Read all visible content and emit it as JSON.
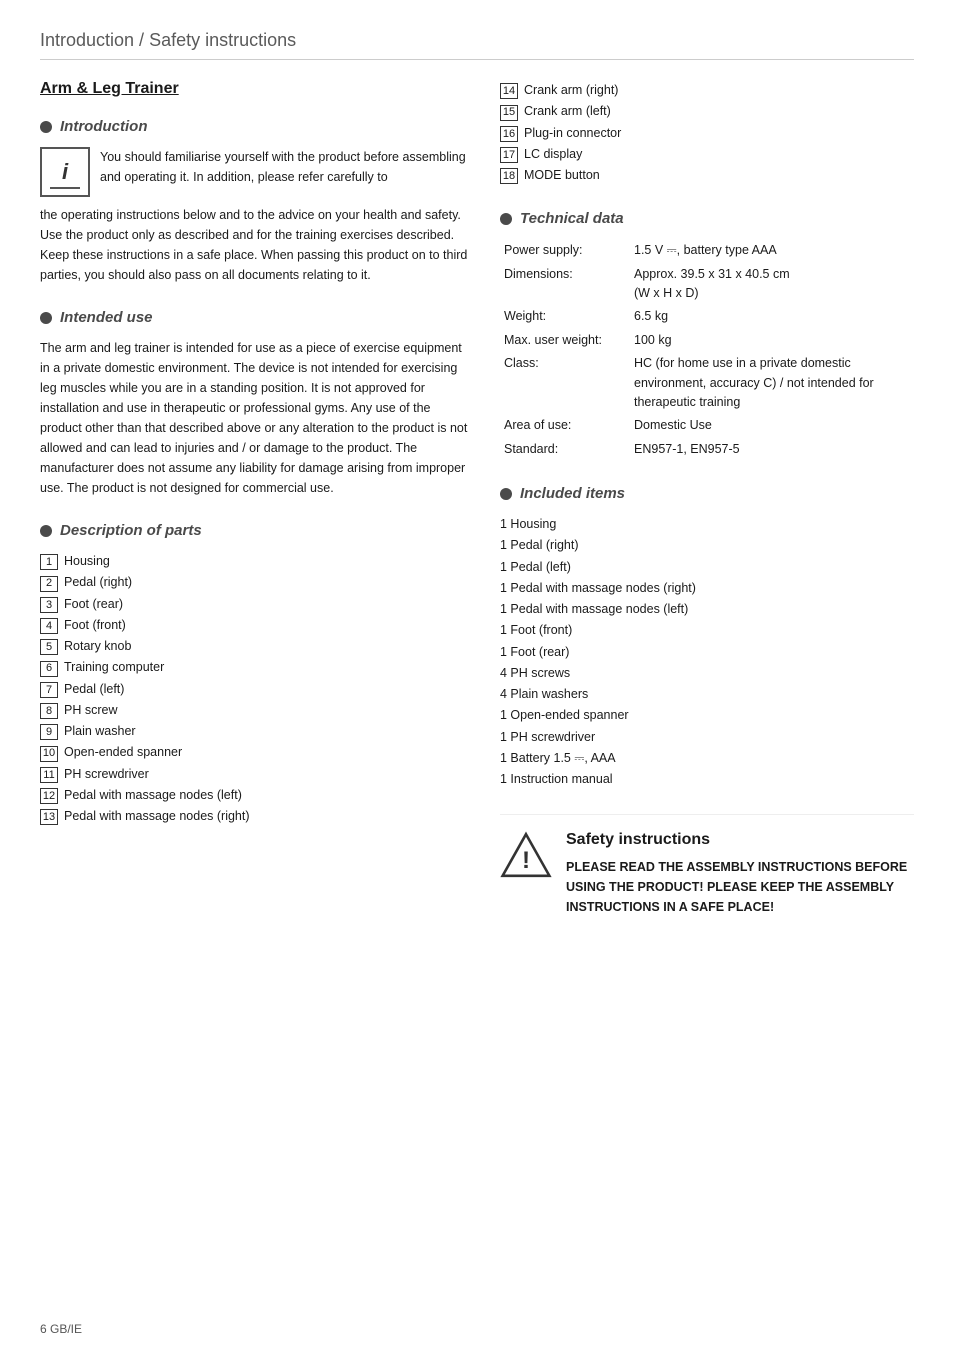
{
  "header": {
    "title": "Introduction / Safety instructions"
  },
  "left_col": {
    "product_title": "Arm & Leg Trainer",
    "intro_section": {
      "heading": "Introduction",
      "text1": "You should familiarise yourself with the product before assembling and operating it. In addition, please refer carefully to the operating instructions below and to the advice on your health and safety. Use the product only as described and for the training exercises described. Keep these instructions in a safe place. When passing this product on to third parties, you should also pass on all documents relating to it."
    },
    "intended_use": {
      "heading": "Intended use",
      "text": "The arm and leg trainer is intended for use as a piece of exercise equipment in a private domestic environment. The device is not intended for exercising leg muscles while you are in a standing position. It is not approved for installation and use in therapeutic or professional gyms. Any use of the product other than that described above or any alteration to the product is not allowed and can lead to injuries and / or damage to the product. The manufacturer does not assume any liability for damage arising from improper use. The product is not designed for commercial use."
    },
    "description_of_parts": {
      "heading": "Description of parts",
      "items": [
        {
          "num": "1",
          "label": "Housing"
        },
        {
          "num": "2",
          "label": "Pedal (right)"
        },
        {
          "num": "3",
          "label": "Foot (rear)"
        },
        {
          "num": "4",
          "label": "Foot (front)"
        },
        {
          "num": "5",
          "label": "Rotary knob"
        },
        {
          "num": "6",
          "label": "Training computer"
        },
        {
          "num": "7",
          "label": "Pedal (left)"
        },
        {
          "num": "8",
          "label": "PH screw"
        },
        {
          "num": "9",
          "label": "Plain washer"
        },
        {
          "num": "10",
          "label": "Open-ended spanner"
        },
        {
          "num": "11",
          "label": "PH screwdriver"
        },
        {
          "num": "12",
          "label": "Pedal with massage nodes (left)"
        },
        {
          "num": "13",
          "label": "Pedal with massage nodes (right)"
        }
      ]
    }
  },
  "right_col": {
    "parts_continued": [
      {
        "num": "14",
        "label": "Crank arm (right)"
      },
      {
        "num": "15",
        "label": "Crank arm (left)"
      },
      {
        "num": "16",
        "label": "Plug-in connector"
      },
      {
        "num": "17",
        "label": "LC display"
      },
      {
        "num": "18",
        "label": "MODE button"
      }
    ],
    "technical_data": {
      "heading": "Technical data",
      "rows": [
        {
          "label": "Power supply:",
          "value": "1.5 V ⎓, battery type AAA"
        },
        {
          "label": "Dimensions:",
          "value": "Approx. 39.5 x 31 x 40.5 cm\n(W x H x D)"
        },
        {
          "label": "Weight:",
          "value": "6.5 kg"
        },
        {
          "label": "Max. user weight:",
          "value": "100 kg"
        },
        {
          "label": "Class:",
          "value": "HC (for home use in a private domestic environment, accuracy C) / not intended for therapeutic training"
        },
        {
          "label": "Area of use:",
          "value": "Domestic Use"
        },
        {
          "label": "Standard:",
          "value": "EN957-1, EN957-5"
        }
      ]
    },
    "included_items": {
      "heading": "Included items",
      "items": [
        "1  Housing",
        "1  Pedal (right)",
        "1  Pedal (left)",
        "1  Pedal with massage nodes (right)",
        "1  Pedal with massage nodes (left)",
        "1  Foot (front)",
        "1  Foot (rear)",
        "4  PH screws",
        "4  Plain washers",
        "1  Open-ended spanner",
        "1  PH screwdriver",
        "1  Battery 1.5 ⎓, AAA",
        "1  Instruction manual"
      ]
    },
    "safety": {
      "heading": "Safety instructions",
      "text": "PLEASE READ THE ASSEMBLY INSTRUCTIONS BEFORE USING THE PRODUCT! PLEASE KEEP THE ASSEMBLY INSTRUCTIONS IN A SAFE PLACE!"
    }
  },
  "footer": {
    "text": "6     GB/IE"
  }
}
